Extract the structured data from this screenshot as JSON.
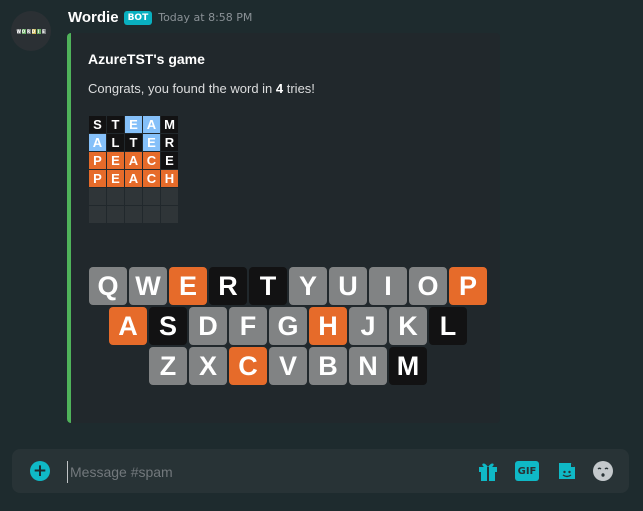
{
  "message": {
    "username": "Wordie",
    "bot_badge": "BOT",
    "timestamp": "Today at 8:58 PM",
    "avatar_letters": [
      "W",
      "O",
      "R",
      "D",
      "I",
      "E"
    ]
  },
  "embed": {
    "title": "AzureTST's game",
    "desc_prefix": "Congrats, you found the word in ",
    "tries": "4",
    "desc_suffix": " tries!",
    "accent_color": "#4fb25a",
    "grid": [
      [
        {
          "l": "S",
          "s": "absent"
        },
        {
          "l": "T",
          "s": "absent"
        },
        {
          "l": "E",
          "s": "present"
        },
        {
          "l": "A",
          "s": "present"
        },
        {
          "l": "M",
          "s": "absent"
        }
      ],
      [
        {
          "l": "A",
          "s": "present"
        },
        {
          "l": "L",
          "s": "absent"
        },
        {
          "l": "T",
          "s": "absent"
        },
        {
          "l": "E",
          "s": "present"
        },
        {
          "l": "R",
          "s": "absent"
        }
      ],
      [
        {
          "l": "P",
          "s": "correct"
        },
        {
          "l": "E",
          "s": "correct"
        },
        {
          "l": "A",
          "s": "correct"
        },
        {
          "l": "C",
          "s": "correct"
        },
        {
          "l": "E",
          "s": "absent"
        }
      ],
      [
        {
          "l": "P",
          "s": "correct"
        },
        {
          "l": "E",
          "s": "correct"
        },
        {
          "l": "A",
          "s": "correct"
        },
        {
          "l": "C",
          "s": "correct"
        },
        {
          "l": "H",
          "s": "correct"
        }
      ],
      [
        {
          "l": "",
          "s": "empty"
        },
        {
          "l": "",
          "s": "empty"
        },
        {
          "l": "",
          "s": "empty"
        },
        {
          "l": "",
          "s": "empty"
        },
        {
          "l": "",
          "s": "empty"
        }
      ],
      [
        {
          "l": "",
          "s": "empty"
        },
        {
          "l": "",
          "s": "empty"
        },
        {
          "l": "",
          "s": "empty"
        },
        {
          "l": "",
          "s": "empty"
        },
        {
          "l": "",
          "s": "empty"
        }
      ]
    ],
    "keyboard": [
      [
        {
          "k": "Q",
          "s": "unused"
        },
        {
          "k": "W",
          "s": "unused"
        },
        {
          "k": "E",
          "s": "correct"
        },
        {
          "k": "R",
          "s": "absent"
        },
        {
          "k": "T",
          "s": "absent"
        },
        {
          "k": "Y",
          "s": "unused"
        },
        {
          "k": "U",
          "s": "unused"
        },
        {
          "k": "I",
          "s": "unused"
        },
        {
          "k": "O",
          "s": "unused"
        },
        {
          "k": "P",
          "s": "correct"
        }
      ],
      [
        {
          "k": "A",
          "s": "correct"
        },
        {
          "k": "S",
          "s": "absent"
        },
        {
          "k": "D",
          "s": "unused"
        },
        {
          "k": "F",
          "s": "unused"
        },
        {
          "k": "G",
          "s": "unused"
        },
        {
          "k": "H",
          "s": "correct"
        },
        {
          "k": "J",
          "s": "unused"
        },
        {
          "k": "K",
          "s": "unused"
        },
        {
          "k": "L",
          "s": "absent"
        }
      ],
      [
        {
          "k": "Z",
          "s": "unused"
        },
        {
          "k": "X",
          "s": "unused"
        },
        {
          "k": "C",
          "s": "correct"
        },
        {
          "k": "V",
          "s": "unused"
        },
        {
          "k": "B",
          "s": "unused"
        },
        {
          "k": "N",
          "s": "unused"
        },
        {
          "k": "M",
          "s": "absent"
        }
      ]
    ]
  },
  "composer": {
    "placeholder": "Message #spam",
    "icons": [
      "plus-icon",
      "gift-icon",
      "gif-icon",
      "sticker-icon",
      "emoji-icon"
    ],
    "gif_label": "GIF"
  },
  "colors": {
    "background": "#1e2b2e",
    "correct": "#e66b2a",
    "present": "#85c0f9",
    "absent": "#121213",
    "unused": "#818384",
    "bot_badge": "#09b0c0"
  }
}
